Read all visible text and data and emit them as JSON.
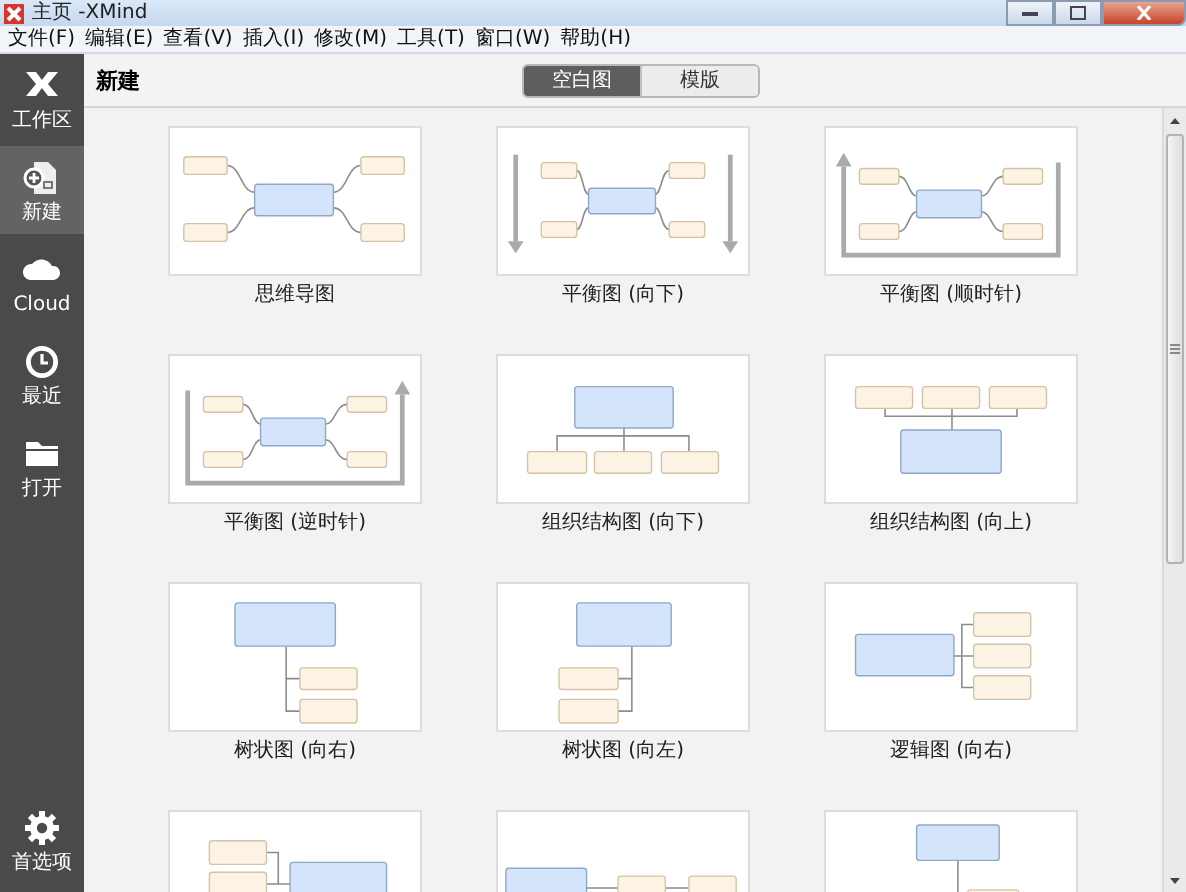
{
  "window": {
    "title": "主页 -XMind"
  },
  "menu": [
    "文件(F)",
    "编辑(E)",
    "查看(V)",
    "插入(I)",
    "修改(M)",
    "工具(T)",
    "窗口(W)",
    "帮助(H)"
  ],
  "sidebar": {
    "items": [
      {
        "kind": "logo",
        "label": "工作区",
        "selected": false
      },
      {
        "kind": "new",
        "label": "新建",
        "selected": true
      },
      {
        "kind": "cloud",
        "label": "Cloud",
        "selected": false
      },
      {
        "kind": "recent",
        "label": "最近",
        "selected": false
      },
      {
        "kind": "open",
        "label": "打开",
        "selected": false
      }
    ],
    "footer": {
      "kind": "gear",
      "label": "首选项"
    }
  },
  "header": {
    "title": "新建",
    "tabs": [
      {
        "label": "空白图",
        "selected": true
      },
      {
        "label": "模版",
        "selected": false
      }
    ]
  },
  "templates": [
    {
      "kind": "mindmap",
      "label": "思维导图"
    },
    {
      "kind": "balance-down",
      "label": "平衡图 (向下)"
    },
    {
      "kind": "balance-cw",
      "label": "平衡图 (顺时针)"
    },
    {
      "kind": "balance-ccw",
      "label": "平衡图 (逆时针)"
    },
    {
      "kind": "org-down",
      "label": "组织结构图 (向下)"
    },
    {
      "kind": "org-up",
      "label": "组织结构图 (向上)"
    },
    {
      "kind": "tree-right",
      "label": "树状图 (向右)"
    },
    {
      "kind": "tree-left",
      "label": "树状图 (向左)"
    },
    {
      "kind": "logic-right",
      "label": "逻辑图 (向右)"
    },
    {
      "kind": "logic-left"
    },
    {
      "kind": "timeline"
    },
    {
      "kind": "tree-down"
    }
  ]
}
